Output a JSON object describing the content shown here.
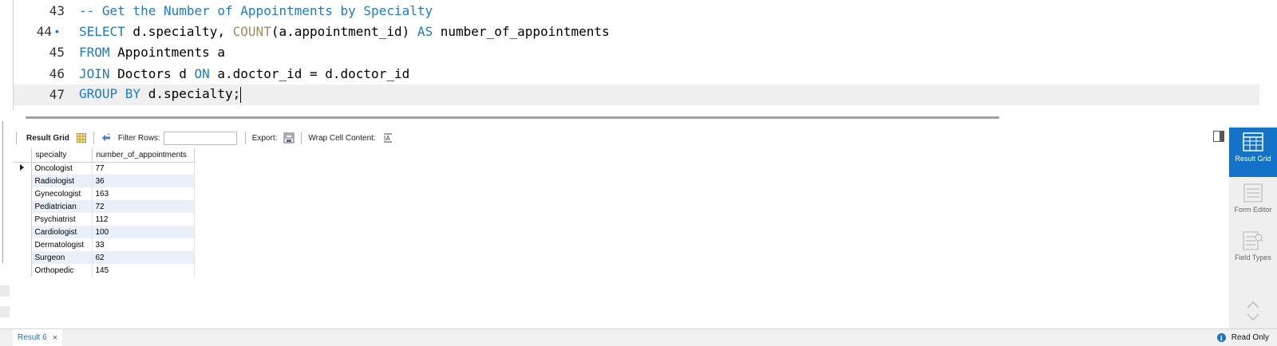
{
  "editor": {
    "lines": [
      {
        "number": "43",
        "segments": [
          {
            "t": "-- Get the Number of Appointments by Specialty",
            "c": "cm"
          }
        ]
      },
      {
        "number": "44",
        "marker": "•",
        "segments": [
          {
            "t": "SELECT",
            "c": "kw"
          },
          {
            "t": " d.specialty, ",
            "c": ""
          },
          {
            "t": "COUNT",
            "c": "fn"
          },
          {
            "t": "(a.appointment_id) ",
            "c": ""
          },
          {
            "t": "AS",
            "c": "kw"
          },
          {
            "t": " number_of_appointments",
            "c": ""
          }
        ]
      },
      {
        "number": "45",
        "segments": [
          {
            "t": "FROM",
            "c": "kw"
          },
          {
            "t": " Appointments a",
            "c": ""
          }
        ]
      },
      {
        "number": "46",
        "segments": [
          {
            "t": "JOIN",
            "c": "kw"
          },
          {
            "t": " Doctors d ",
            "c": ""
          },
          {
            "t": "ON",
            "c": "kw"
          },
          {
            "t": " a.doctor_id = d.doctor_id",
            "c": ""
          }
        ]
      },
      {
        "number": "47",
        "current": true,
        "segments": [
          {
            "t": "GROUP BY",
            "c": "kw"
          },
          {
            "t": " d.specialty;",
            "c": ""
          }
        ]
      }
    ]
  },
  "toolbar": {
    "result_grid_label": "Result Grid",
    "filter_rows_label": "Filter Rows:",
    "filter_value": "",
    "export_label": "Export:",
    "wrap_label": "Wrap Cell Content:"
  },
  "grid": {
    "columns": [
      "specialty",
      "number_of_appointments"
    ],
    "rows": [
      [
        "Oncologist",
        "77"
      ],
      [
        "Radiologist",
        "36"
      ],
      [
        "Gynecologist",
        "163"
      ],
      [
        "Pediatrician",
        "72"
      ],
      [
        "Psychiatrist",
        "112"
      ],
      [
        "Cardiologist",
        "100"
      ],
      [
        "Dermatologist",
        "33"
      ],
      [
        "Surgeon",
        "62"
      ],
      [
        "Orthopedic",
        "145"
      ]
    ]
  },
  "side_panel": {
    "result_grid": "Result Grid",
    "form_editor": "Form Editor",
    "field_types": "Field Types"
  },
  "bottom": {
    "tab_label": "Result 6",
    "close_glyph": "×",
    "status": "Read Only",
    "info_glyph": "i"
  },
  "colors": {
    "keyword": "#1e7ac9",
    "function": "#a38b61",
    "accent": "#1473c6",
    "alt_row": "#e9f0fa"
  }
}
